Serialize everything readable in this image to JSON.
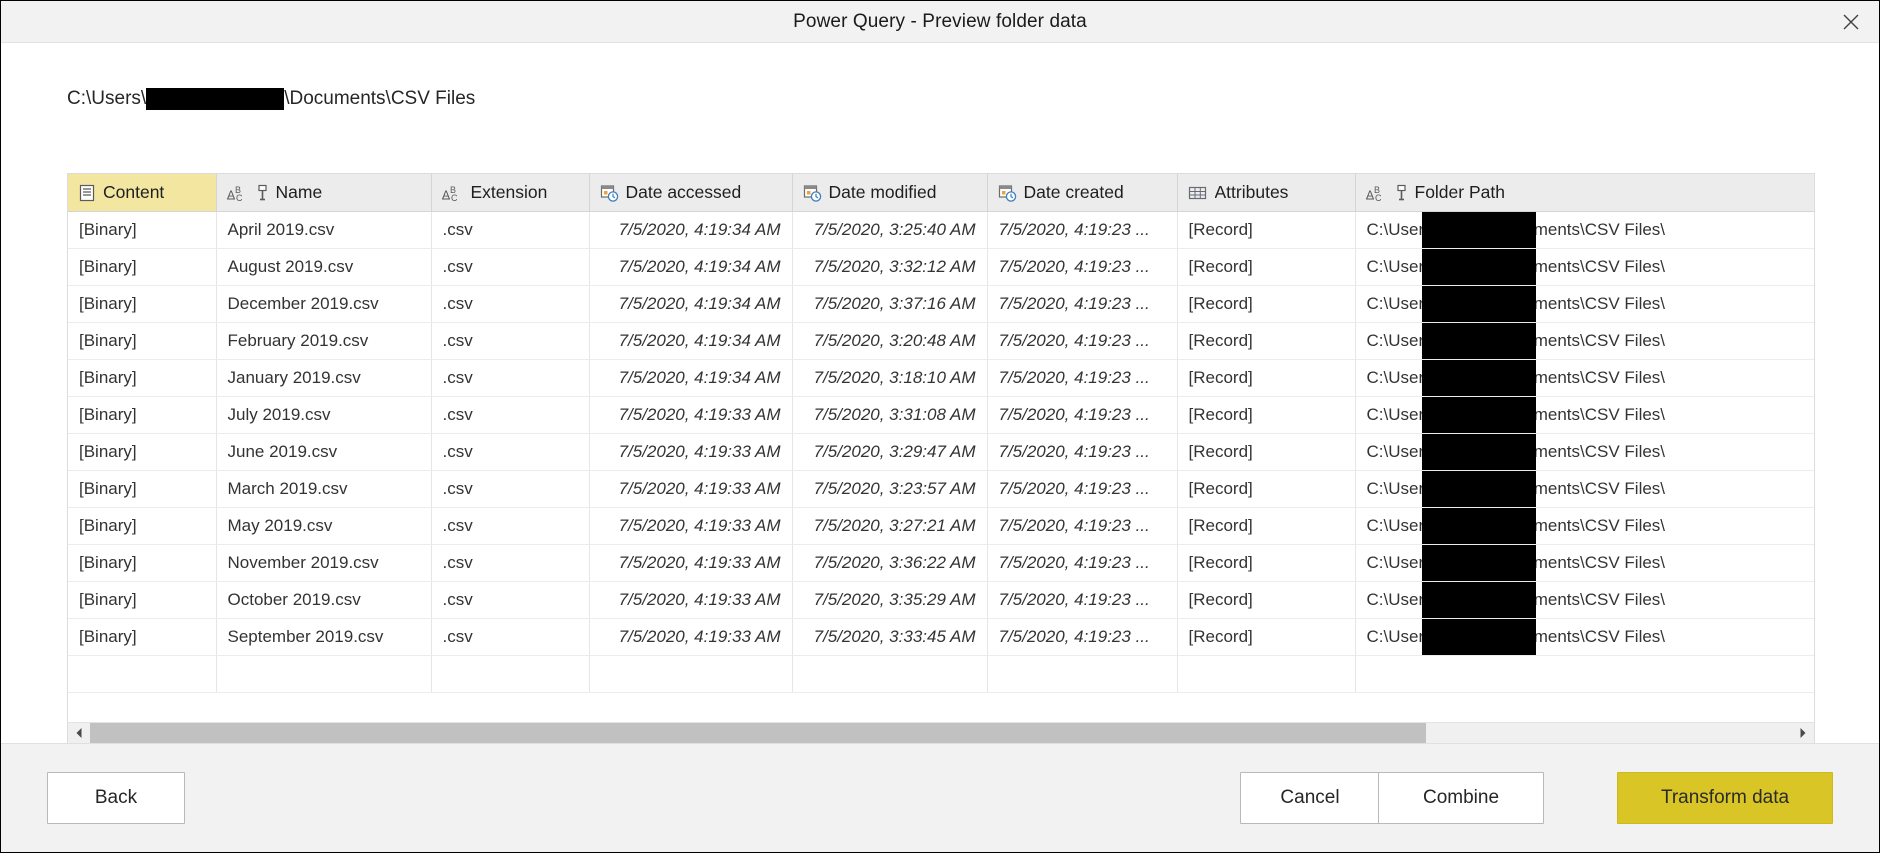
{
  "window": {
    "title": "Power Query - Preview folder data",
    "close_label": "×",
    "close_icon": "close-icon"
  },
  "path": {
    "prefix": "C:\\Users\\",
    "redacted": "",
    "suffix": "\\Documents\\CSV Files"
  },
  "table": {
    "selected_column": "Content",
    "columns": [
      {
        "label": "Content",
        "icon": "list-document-icon",
        "type": "binary",
        "align": "left",
        "selected": true
      },
      {
        "label": "Name",
        "icon": "abc-text-icon",
        "type": "text",
        "align": "left",
        "selected": false,
        "extra_icon": "filter-icon"
      },
      {
        "label": "Extension",
        "icon": "abc-text-icon",
        "type": "text",
        "align": "left",
        "selected": false
      },
      {
        "label": "Date accessed",
        "icon": "calendar-clock-icon",
        "type": "datetime",
        "align": "right",
        "selected": false
      },
      {
        "label": "Date modified",
        "icon": "calendar-clock-icon",
        "type": "datetime",
        "align": "right",
        "selected": false
      },
      {
        "label": "Date created",
        "icon": "calendar-clock-icon",
        "type": "datetime",
        "align": "left",
        "selected": false
      },
      {
        "label": "Attributes",
        "icon": "table-record-icon",
        "type": "record",
        "align": "left",
        "selected": false
      },
      {
        "label": "Folder Path",
        "icon": "abc-text-icon",
        "type": "text",
        "align": "left",
        "selected": false,
        "extra_icon": "filter-icon"
      }
    ],
    "rows": [
      {
        "content": "[Binary]",
        "name": "April 2019.csv",
        "extension": ".csv",
        "accessed": "7/5/2020, 4:19:34 AM",
        "modified": "7/5/2020, 3:25:40 AM",
        "created": "7/5/2020, 4:19:23 ...",
        "attributes": "[Record]",
        "folder_prefix": "C:\\Users\\",
        "folder_suffix": "Documents\\CSV Files\\"
      },
      {
        "content": "[Binary]",
        "name": "August 2019.csv",
        "extension": ".csv",
        "accessed": "7/5/2020, 4:19:34 AM",
        "modified": "7/5/2020, 3:32:12 AM",
        "created": "7/5/2020, 4:19:23 ...",
        "attributes": "[Record]",
        "folder_prefix": "C:\\Users\\",
        "folder_suffix": "Documents\\CSV Files\\"
      },
      {
        "content": "[Binary]",
        "name": "December 2019.csv",
        "extension": ".csv",
        "accessed": "7/5/2020, 4:19:34 AM",
        "modified": "7/5/2020, 3:37:16 AM",
        "created": "7/5/2020, 4:19:23 ...",
        "attributes": "[Record]",
        "folder_prefix": "C:\\Users\\",
        "folder_suffix": "Documents\\CSV Files\\"
      },
      {
        "content": "[Binary]",
        "name": "February 2019.csv",
        "extension": ".csv",
        "accessed": "7/5/2020, 4:19:34 AM",
        "modified": "7/5/2020, 3:20:48 AM",
        "created": "7/5/2020, 4:19:23 ...",
        "attributes": "[Record]",
        "folder_prefix": "C:\\Users\\",
        "folder_suffix": "Documents\\CSV Files\\"
      },
      {
        "content": "[Binary]",
        "name": "January 2019.csv",
        "extension": ".csv",
        "accessed": "7/5/2020, 4:19:34 AM",
        "modified": "7/5/2020, 3:18:10 AM",
        "created": "7/5/2020, 4:19:23 ...",
        "attributes": "[Record]",
        "folder_prefix": "C:\\Users\\",
        "folder_suffix": "Documents\\CSV Files\\"
      },
      {
        "content": "[Binary]",
        "name": "July 2019.csv",
        "extension": ".csv",
        "accessed": "7/5/2020, 4:19:33 AM",
        "modified": "7/5/2020, 3:31:08 AM",
        "created": "7/5/2020, 4:19:23 ...",
        "attributes": "[Record]",
        "folder_prefix": "C:\\Users\\",
        "folder_suffix": "Documents\\CSV Files\\"
      },
      {
        "content": "[Binary]",
        "name": "June 2019.csv",
        "extension": ".csv",
        "accessed": "7/5/2020, 4:19:33 AM",
        "modified": "7/5/2020, 3:29:47 AM",
        "created": "7/5/2020, 4:19:23 ...",
        "attributes": "[Record]",
        "folder_prefix": "C:\\Users\\",
        "folder_suffix": "Documents\\CSV Files\\"
      },
      {
        "content": "[Binary]",
        "name": "March 2019.csv",
        "extension": ".csv",
        "accessed": "7/5/2020, 4:19:33 AM",
        "modified": "7/5/2020, 3:23:57 AM",
        "created": "7/5/2020, 4:19:23 ...",
        "attributes": "[Record]",
        "folder_prefix": "C:\\Users\\",
        "folder_suffix": "Documents\\CSV Files\\"
      },
      {
        "content": "[Binary]",
        "name": "May 2019.csv",
        "extension": ".csv",
        "accessed": "7/5/2020, 4:19:33 AM",
        "modified": "7/5/2020, 3:27:21 AM",
        "created": "7/5/2020, 4:19:23 ...",
        "attributes": "[Record]",
        "folder_prefix": "C:\\Users\\",
        "folder_suffix": "Documents\\CSV Files\\"
      },
      {
        "content": "[Binary]",
        "name": "November 2019.csv",
        "extension": ".csv",
        "accessed": "7/5/2020, 4:19:33 AM",
        "modified": "7/5/2020, 3:36:22 AM",
        "created": "7/5/2020, 4:19:23 ...",
        "attributes": "[Record]",
        "folder_prefix": "C:\\Users\\",
        "folder_suffix": "Documents\\CSV Files\\"
      },
      {
        "content": "[Binary]",
        "name": "October 2019.csv",
        "extension": ".csv",
        "accessed": "7/5/2020, 4:19:33 AM",
        "modified": "7/5/2020, 3:35:29 AM",
        "created": "7/5/2020, 4:19:23 ...",
        "attributes": "[Record]",
        "folder_prefix": "C:\\Users\\",
        "folder_suffix": "Documents\\CSV Files\\"
      },
      {
        "content": "[Binary]",
        "name": "September 2019.csv",
        "extension": ".csv",
        "accessed": "7/5/2020, 4:19:33 AM",
        "modified": "7/5/2020, 3:33:45 AM",
        "created": "7/5/2020, 4:19:23 ...",
        "attributes": "[Record]",
        "folder_prefix": "C:\\Users\\",
        "folder_suffix": "Documents\\CSV Files\\"
      }
    ]
  },
  "scrollbar": {
    "left_arrow_icon": "chevron-left-icon",
    "right_arrow_icon": "chevron-right-icon",
    "thumb_fraction": 0.785
  },
  "footer": {
    "back_label": "Back",
    "cancel_label": "Cancel",
    "combine_label": "Combine",
    "transform_label": "Transform data"
  },
  "colors": {
    "accent": "#d9c526",
    "link_value": "#9a8429",
    "header_bg": "#ececec",
    "selected_header_bg": "#f2e6a0",
    "chrome_bg": "#f2f2f2"
  }
}
